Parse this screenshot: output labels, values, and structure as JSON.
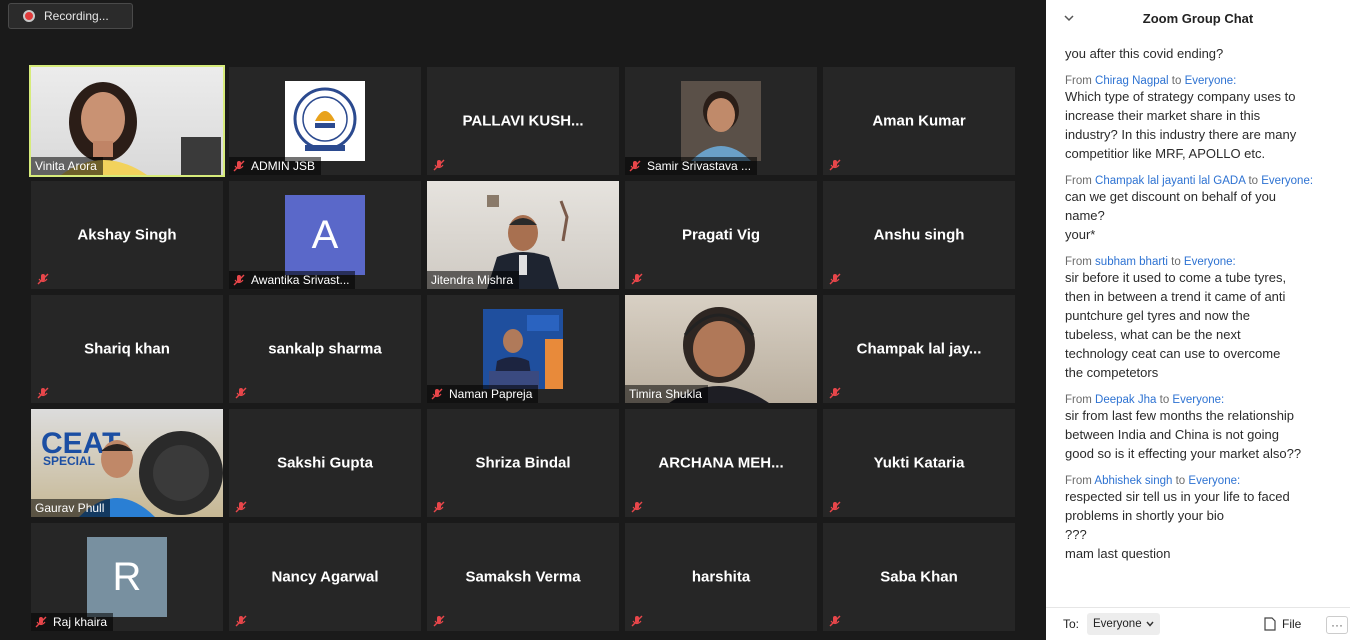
{
  "recording": {
    "label": "Recording..."
  },
  "tiles": [
    {
      "name": "Vinita Arora"
    },
    {
      "name": "ADMIN JSB"
    },
    {
      "name": "PALLAVI KUSH..."
    },
    {
      "name": "Samir Srivastava ..."
    },
    {
      "name": "Aman Kumar"
    },
    {
      "name": "Akshay Singh"
    },
    {
      "name": "Awantika Srivast...",
      "avatar_letter": "A",
      "avatar_color": "#5a68c9"
    },
    {
      "name": "Jitendra Mishra"
    },
    {
      "name": "Pragati Vig"
    },
    {
      "name": "Anshu singh"
    },
    {
      "name": "Shariq khan"
    },
    {
      "name": "sankalp sharma"
    },
    {
      "name": "Naman Papreja"
    },
    {
      "name": "Timira Shukla"
    },
    {
      "name": "Champak  lal  jay..."
    },
    {
      "name": "Gaurav Phull",
      "logo_text": "CEAT",
      "logo_sub": "SPECIAL"
    },
    {
      "name": "Sakshi Gupta"
    },
    {
      "name": "Shriza Bindal"
    },
    {
      "name": "ARCHANA  MEH..."
    },
    {
      "name": "Yukti Kataria"
    },
    {
      "name": "Raj khaira",
      "avatar_letter": "R",
      "avatar_color": "#7890a0"
    },
    {
      "name": "Nancy Agarwal"
    },
    {
      "name": "Samaksh Verma"
    },
    {
      "name": "harshita"
    },
    {
      "name": "Saba Khan"
    }
  ],
  "chat": {
    "title": "Zoom Group Chat",
    "from_word": "From",
    "to_word": "to",
    "top_fragment": "you after this covid ending?",
    "messages": [
      {
        "from": "Chirag Nagpal",
        "to": "Everyone:",
        "lines": [
          "Which type of strategy company uses to",
          "increase their market share in this",
          "industry? In this industry there are many",
          "competitior like MRF, APOLLO etc."
        ]
      },
      {
        "from": "Champak lal jayanti lal GADA",
        "to": "Everyone:",
        "lines": [
          "can we get discount on behalf of you",
          "name?",
          "your*"
        ]
      },
      {
        "from": "subham bharti",
        "to": "Everyone:",
        "lines": [
          "sir before it used to come a tube tyres,",
          "then in between a trend it came of anti",
          "puntchure gel tyres and now the",
          "tubeless, what can be the next",
          "technology ceat can use to overcome",
          "the competetors"
        ]
      },
      {
        "from": "Deepak Jha",
        "to": "Everyone:",
        "lines": [
          "sir from last few months the relationship",
          "between India and China is not going",
          "good so is it effecting your market also??"
        ]
      },
      {
        "from": "Abhishek singh",
        "to": "Everyone:",
        "lines": [
          "respected sir tell  us in your life to faced",
          "problems in shortly your bio",
          "???",
          "mam last question"
        ]
      }
    ],
    "footer": {
      "to_label": "To:",
      "recipient": "Everyone",
      "file_label": "File",
      "more_label": "···"
    }
  }
}
